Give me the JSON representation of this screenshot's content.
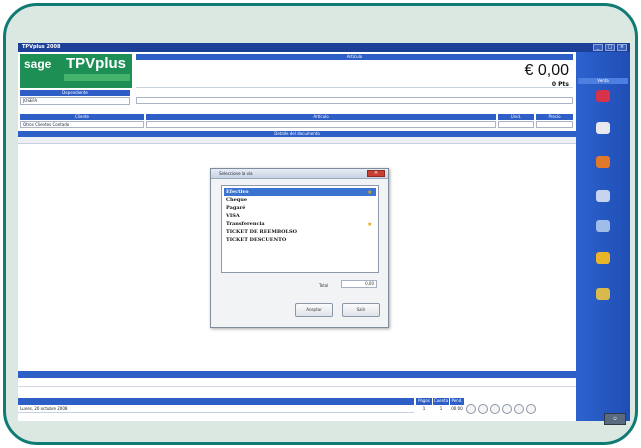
{
  "window": {
    "title": "TPVplus 2008"
  },
  "logo": {
    "brand": "sage",
    "product": "TPVplus"
  },
  "header": {
    "article_label": "Artículo",
    "price": "€ 0,00",
    "price_pts": "0 Pts",
    "employee_label": "Dependiente",
    "employee_value": "JOSEFA"
  },
  "client_row": {
    "client_label": "Cliente",
    "client_value": "Otros Clientes Contado",
    "section_label": "Artículo",
    "unit_label": "Unid.",
    "price_label": "Precio"
  },
  "list": {
    "title": "Detalle del documento"
  },
  "dialog": {
    "title": "Seleccione la vía",
    "items": [
      "Efectivo",
      "Cheque",
      "Pagaré",
      "VISA",
      "Transferencia",
      "TICKET DE REEMBOLSO",
      "TICKET DESCUENTO"
    ],
    "total_label": "Total",
    "total_value": "0,00",
    "accept_label": "Aceptar",
    "exit_label": "Salir"
  },
  "footer": {
    "date_text": "Lunes, 20 octubre 2008",
    "hdr_pagos": "Pagos",
    "hdr_cuenta": "Cuenta",
    "hdr_pend": "Pend.",
    "val_1": "1",
    "val_2": "1",
    "val_3": "00:00"
  },
  "side_panel": {
    "header": "Venta"
  }
}
